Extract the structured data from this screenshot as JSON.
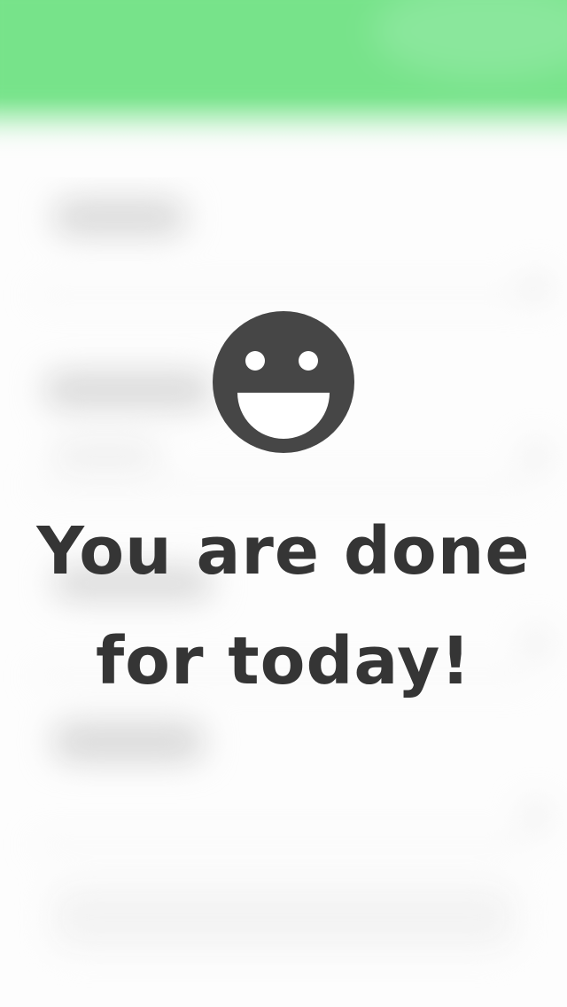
{
  "message": {
    "line1": "You are done",
    "line2": "for today!",
    "icon": "smiley-face-icon"
  },
  "colors": {
    "accent_green": "#77e38a",
    "text_dark": "#353535",
    "background": "#fdfdfd"
  }
}
